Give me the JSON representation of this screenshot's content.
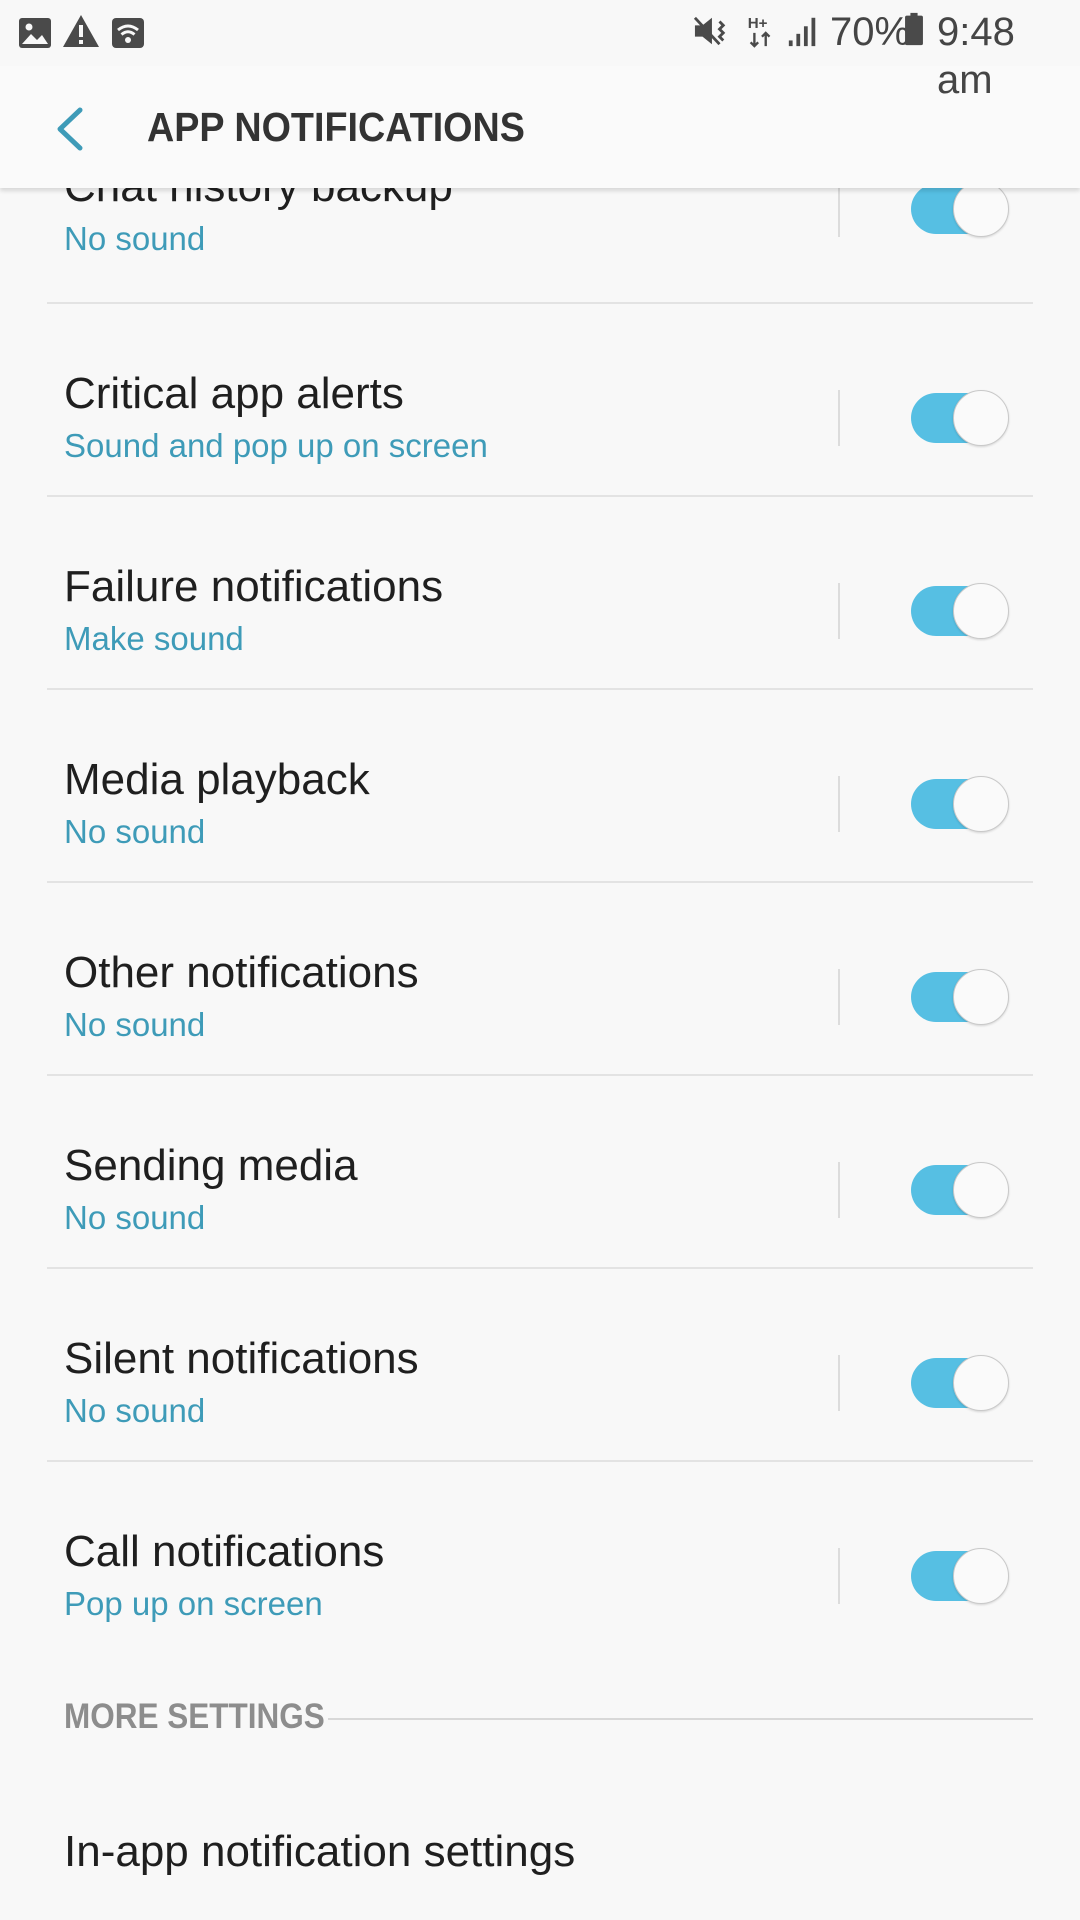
{
  "status_bar": {
    "battery_percent": "70%",
    "time": "9:48 am",
    "icons": [
      "gallery-icon",
      "warning-icon",
      "wifi-icon",
      "vibrate-mute-icon",
      "hplus-data-icon",
      "signal-icon",
      "battery-icon"
    ]
  },
  "app_bar": {
    "title": "APP NOTIFICATIONS",
    "back_icon": "chevron-left-icon"
  },
  "colors": {
    "accent": "#56bfe3",
    "subtitle": "#3e9bb8",
    "back_arrow": "#3e9bb8"
  },
  "channels": [
    {
      "title": "Chat history backup",
      "subtitle": "No sound",
      "enabled": true
    },
    {
      "title": "Critical app alerts",
      "subtitle": "Sound and pop up on screen",
      "enabled": true
    },
    {
      "title": "Failure notifications",
      "subtitle": "Make sound",
      "enabled": true
    },
    {
      "title": "Media playback",
      "subtitle": "No sound",
      "enabled": true
    },
    {
      "title": "Other notifications",
      "subtitle": "No sound",
      "enabled": true
    },
    {
      "title": "Sending media",
      "subtitle": "No sound",
      "enabled": true
    },
    {
      "title": "Silent notifications",
      "subtitle": "No sound",
      "enabled": true
    },
    {
      "title": "Call notifications",
      "subtitle": "Pop up on screen",
      "enabled": true
    }
  ],
  "more_settings": {
    "header": "MORE SETTINGS",
    "item_label": "In-app notification settings"
  }
}
